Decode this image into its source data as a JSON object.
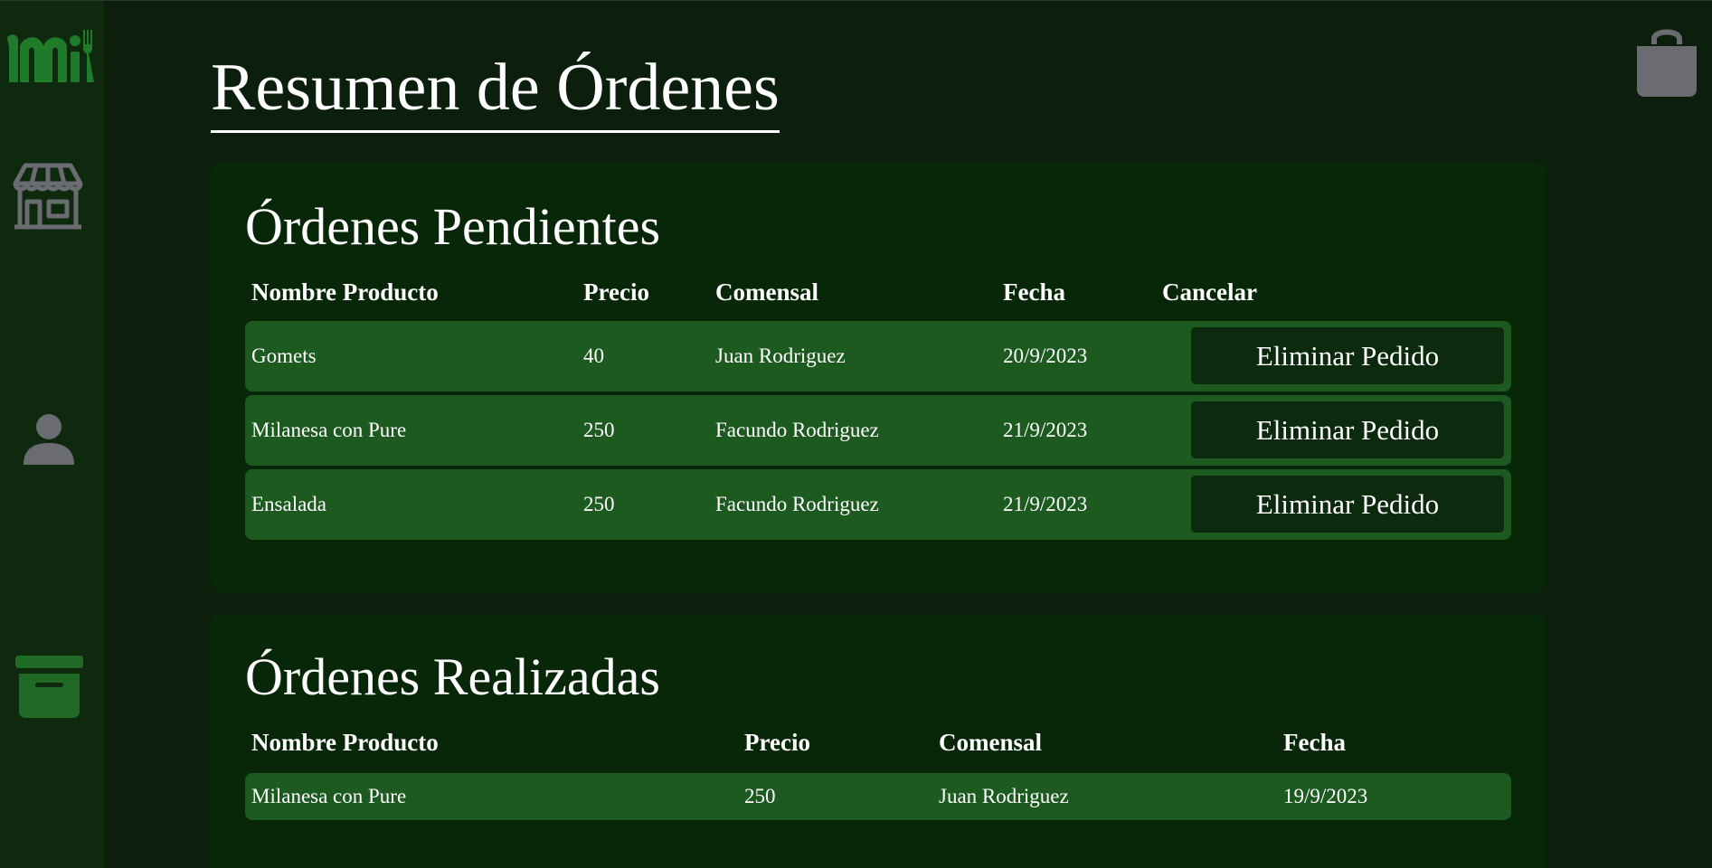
{
  "page": {
    "title": "Resumen de Órdenes"
  },
  "sidebar": {
    "icons": [
      "logo-icon",
      "store-icon",
      "user-icon",
      "archive-icon"
    ],
    "colors": {
      "logo": "#1f7a2a",
      "icon": "#6b6b72",
      "archive": "#1f6a24"
    }
  },
  "header": {
    "bag_icon": "shopping-bag-icon"
  },
  "pending": {
    "title": "Órdenes Pendientes",
    "headers": [
      "Nombre Producto",
      "Precio",
      "Comensal",
      "Fecha",
      "Cancelar"
    ],
    "rows": [
      {
        "product": "Gomets",
        "price": "40",
        "diner": "Juan Rodriguez",
        "date": "20/9/2023",
        "action": "Eliminar Pedido"
      },
      {
        "product": "Milanesa con Pure",
        "price": "250",
        "diner": "Facundo Rodriguez",
        "date": "21/9/2023",
        "action": "Eliminar Pedido"
      },
      {
        "product": "Ensalada",
        "price": "250",
        "diner": "Facundo Rodriguez",
        "date": "21/9/2023",
        "action": "Eliminar Pedido"
      }
    ]
  },
  "done": {
    "title": "Órdenes Realizadas",
    "headers": [
      "Nombre Producto",
      "Precio",
      "Comensal",
      "Fecha"
    ],
    "rows": [
      {
        "product": "Milanesa con Pure",
        "price": "250",
        "diner": "Juan Rodriguez",
        "date": "19/9/2023"
      }
    ]
  }
}
